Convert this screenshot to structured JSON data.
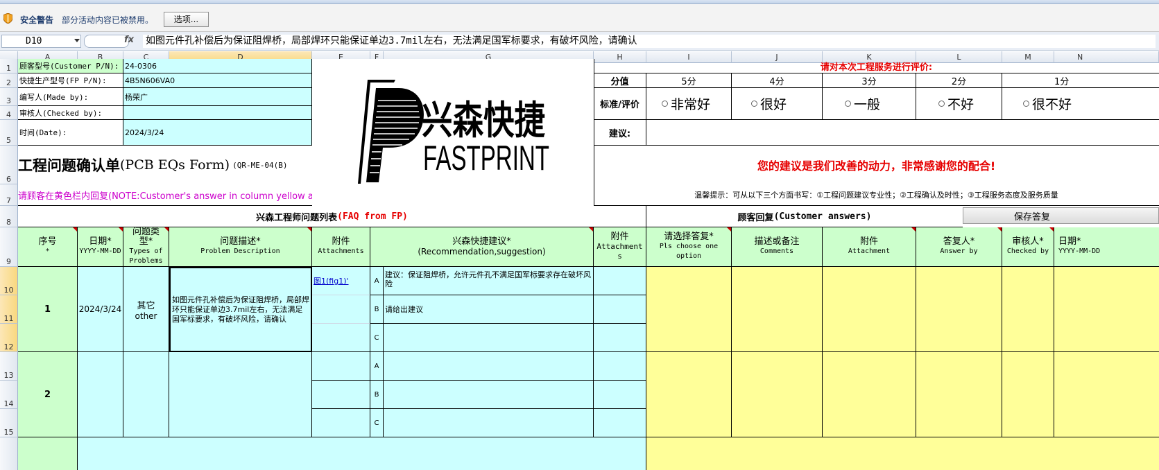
{
  "security_bar": {
    "title": "安全警告",
    "message": "部分活动内容已被禁用。",
    "options_button": "选项..."
  },
  "formula_bar": {
    "cell_ref": "D10",
    "fx": "fx",
    "formula": "如图元件孔补偿后为保证阻焊桥，局部焊环只能保证单边3.7mil左右，无法满足国军标要求，有破坏风险，请确认"
  },
  "columns": [
    "A",
    "B",
    "C",
    "D",
    "E",
    "F",
    "G",
    "H",
    "I",
    "J",
    "K",
    "L",
    "M",
    "N"
  ],
  "rows": [
    "1",
    "2",
    "3",
    "4",
    "5",
    "6",
    "7",
    "8",
    "9",
    "10",
    "11",
    "12",
    "13",
    "14",
    "15"
  ],
  "info": {
    "customer_pn_label": "顾客型号(Customer P/N):",
    "customer_pn": "24-0306",
    "fp_pn_label": "快捷生产型号(FP P/N):",
    "fp_pn": "4B5N606VA0",
    "made_by_label": "编写人(Made by):",
    "made_by": "杨荣广",
    "checked_by_label": "审核人(Checked by):",
    "checked_by": "",
    "date_label": "时间(Date):",
    "date": "2024/3/24",
    "form_title": "工程问题确认单",
    "form_title_en": "(PCB EQs Form)",
    "form_code": "(QR-ME-04(B)",
    "customer_note": "请顾客在黄色栏内回复(NOTE:Customer's answer in column yellow area)"
  },
  "logo": {
    "cn": "兴森快捷",
    "en": "FASTPRINT"
  },
  "rating": {
    "heading": "请对本次工程服务进行评价:",
    "score_label": "分值",
    "scores": [
      "5分",
      "4分",
      "3分",
      "2分",
      "1分"
    ],
    "criteria_label": "标准/评价",
    "options": [
      "非常好",
      "很好",
      "一般",
      "不好",
      "很不好"
    ],
    "suggestion_label": "建议:",
    "thanks": "您的建议是我们改善的动力，非常感谢您的配合!",
    "tip": "温馨提示：可从以下三个方面书写：①工程问题建议专业性；②工程确认及时性；③工程服务态度及服务质量"
  },
  "faq": {
    "left_title": "兴森工程师问题列表",
    "left_title_en": "(FAQ from FP)",
    "right_title": "顾客回复",
    "right_title_en": "(Customer answers)",
    "save_button": "保存答复",
    "headers": {
      "seq": "序号",
      "seq_sub": "*",
      "date": "日期*",
      "date_sub": "YYYY-MM-DD",
      "type": "问题类型*",
      "type_sub": "Types of Problems",
      "desc": "问题描述*",
      "desc_sub": "Problem Description",
      "attach": "附件",
      "attach_sub": "Attachments",
      "rec": "兴森快捷建议*",
      "rec_sub": "(Recommendation,suggestion)",
      "attach2": "附件",
      "attach2_sub": "Attachments",
      "choose": "请选择答复*",
      "choose_sub": "Pls choose one option",
      "comments": "描述或备注",
      "comments_sub": "Comments",
      "attachment": "附件",
      "attachment_sub": "Attachment",
      "answer_by": "答复人*",
      "answer_by_sub": "Answer by",
      "checked_by": "审核人*",
      "checked_by_sub": "Checked by",
      "date2": "日期*",
      "date2_sub": "YYYY-MM-DD"
    },
    "items": [
      {
        "seq": "1",
        "date": "2024/3/24",
        "type": "其它",
        "type_en": "other",
        "desc": "如图元件孔补偿后为保证阻焊桥，局部焊环只能保证单边3.7mil左右，无法满足国军标要求，有破坏风险，请确认",
        "attach": "图1(fig1)'",
        "options": [
          {
            "letter": "A",
            "text": "建议：保证阻焊桥，允许元件孔不满足国军标要求存在破坏风险"
          },
          {
            "letter": "B",
            "text": "请给出建议"
          },
          {
            "letter": "C",
            "text": ""
          }
        ]
      },
      {
        "seq": "2",
        "date": "",
        "type": "",
        "type_en": "",
        "desc": "",
        "attach": "",
        "options": [
          {
            "letter": "A",
            "text": ""
          },
          {
            "letter": "B",
            "text": ""
          },
          {
            "letter": "C",
            "text": ""
          }
        ]
      }
    ]
  },
  "colors": {
    "green": "#ccffcc",
    "cyan": "#ccffff",
    "yellow": "#ffff99",
    "red_text": "#e60000",
    "magenta_text": "#cc00cc"
  }
}
